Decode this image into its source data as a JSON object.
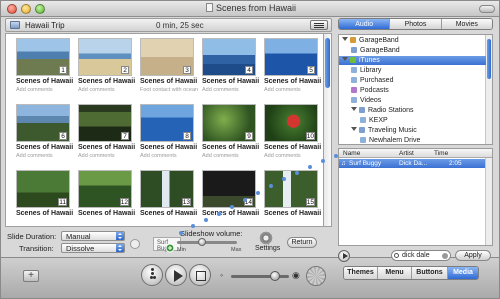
{
  "window": {
    "title": "Scenes from Hawaii"
  },
  "project": {
    "name": "Hawaii Trip",
    "meta": "0 min, 25 sec"
  },
  "slides": [
    {
      "num": "1",
      "title": "Scenes of Hawaii",
      "comment": "Add comments",
      "scene": "coast"
    },
    {
      "num": "2",
      "title": "Scenes of Hawaii",
      "comment": "Add comments",
      "scene": "beach"
    },
    {
      "num": "3",
      "title": "Scenes of Hawaii",
      "comment": "Foot contact with ocean",
      "scene": "feet"
    },
    {
      "num": "4",
      "title": "Scenes of Hawaii",
      "comment": "Add comments",
      "scene": "boat"
    },
    {
      "num": "5",
      "title": "Scenes of Hawaii",
      "comment": "Add comments",
      "scene": "sea"
    },
    {
      "num": "6",
      "title": "Scenes of Hawaii",
      "comment": "Add comments",
      "scene": "cliff"
    },
    {
      "num": "7",
      "title": "Scenes of Hawaii",
      "comment": "Add comments",
      "scene": "palms"
    },
    {
      "num": "8",
      "title": "Scenes of Hawaii",
      "comment": "Add comments",
      "scene": "ocean"
    },
    {
      "num": "9",
      "title": "Scenes of Hawaii",
      "comment": "Add comments",
      "scene": "jungle"
    },
    {
      "num": "10",
      "title": "Scenes of Hawaii",
      "comment": "Add comments",
      "scene": "flower"
    },
    {
      "num": "11",
      "title": "Scenes of Hawaii",
      "comment": "",
      "scene": "tree"
    },
    {
      "num": "12",
      "title": "Scenes of Hawaii",
      "comment": "",
      "scene": "forest"
    },
    {
      "num": "13",
      "title": "Scenes of Hawaii",
      "comment": "",
      "scene": "waterfall"
    },
    {
      "num": "14",
      "title": "Scenes of Hawaii",
      "comment": "",
      "scene": "dark"
    },
    {
      "num": "15",
      "title": "Scenes of Hawaii",
      "comment": "",
      "scene": "falls2"
    }
  ],
  "settings": {
    "slide_duration_label": "Slide Duration:",
    "slide_duration_value": "Manual",
    "transition_label": "Transition:",
    "transition_value": "Dissolve",
    "volume_label": "Slideshow volume:",
    "overlay_text": "Surf Buggy",
    "min_label": "Min",
    "max_label": "Max",
    "settings_label": "Settings",
    "return_label": "Return"
  },
  "bottom_tabs": [
    "Themes",
    "Menu",
    "Buttons",
    "Media"
  ],
  "bottom_tabs_active": "Media",
  "media_tabs": [
    "Audio",
    "Photos",
    "Movies"
  ],
  "media_tabs_active": "Audio",
  "sources": [
    {
      "label": "GarageBand",
      "indent": 0,
      "disclosure": true,
      "color": "#d79a3b"
    },
    {
      "label": "GarageBand",
      "indent": 1,
      "disclosure": false,
      "color": "#7da0d0"
    },
    {
      "label": "iTunes",
      "indent": 0,
      "disclosure": true,
      "color": "#6fbd3c",
      "selected": true
    },
    {
      "label": "Library",
      "indent": 1,
      "disclosure": false,
      "color": "#8fb0d8"
    },
    {
      "label": "Purchased",
      "indent": 1,
      "disclosure": false,
      "color": "#8fb0d8"
    },
    {
      "label": "Podcasts",
      "indent": 1,
      "disclosure": false,
      "color": "#b277cc"
    },
    {
      "label": "Videos",
      "indent": 1,
      "disclosure": false,
      "color": "#8fb0d8"
    },
    {
      "label": "Radio Stations",
      "indent": 1,
      "disclosure": true,
      "color": "#7da0d0"
    },
    {
      "label": "KEXP",
      "indent": 2,
      "disclosure": false,
      "color": "#8fb0d8"
    },
    {
      "label": "Traveling Music",
      "indent": 1,
      "disclosure": true,
      "color": "#7da0d0"
    },
    {
      "label": "Newhalem Drive",
      "indent": 2,
      "disclosure": false,
      "color": "#8fb0d8"
    }
  ],
  "songs": {
    "headers": [
      "Name",
      "Artist",
      "Time"
    ],
    "rows": [
      {
        "name": "Surf Buggy",
        "artist": "Dick Da...",
        "time": "2:05"
      }
    ]
  },
  "search": {
    "value": "dick dale",
    "apply_label": "Apply"
  },
  "icons": [
    "close-icon",
    "minimize-icon",
    "zoom-icon",
    "project-icon",
    "view-toggle-icon",
    "add-icon",
    "walkthrough-icon",
    "play-icon",
    "fullscreen-icon",
    "speaker-icon",
    "gear-icon",
    "search-icon"
  ]
}
